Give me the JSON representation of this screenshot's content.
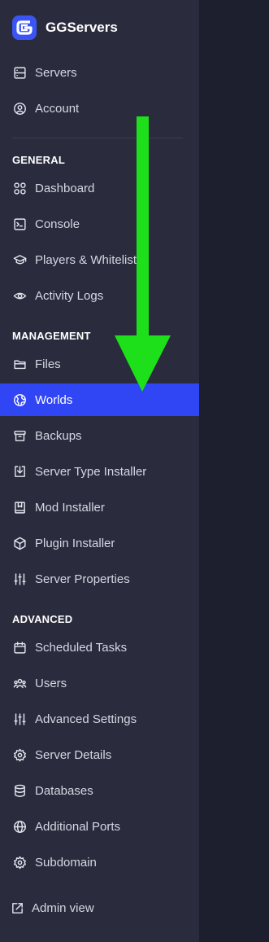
{
  "brand": {
    "name": "GGServers"
  },
  "top_nav": [
    {
      "label": "Servers",
      "icon": "server-icon"
    },
    {
      "label": "Account",
      "icon": "account-icon"
    }
  ],
  "general": {
    "heading": "GENERAL",
    "items": [
      {
        "label": "Dashboard",
        "icon": "dashboard-icon"
      },
      {
        "label": "Console",
        "icon": "console-icon"
      },
      {
        "label": "Players & Whitelist",
        "icon": "graduation-cap-icon"
      },
      {
        "label": "Activity Logs",
        "icon": "eye-icon"
      }
    ]
  },
  "management": {
    "heading": "MANAGEMENT",
    "items": [
      {
        "label": "Files",
        "icon": "folder-icon"
      },
      {
        "label": "Worlds",
        "icon": "globe-icon",
        "active": true
      },
      {
        "label": "Backups",
        "icon": "archive-icon"
      },
      {
        "label": "Server Type Installer",
        "icon": "download-icon"
      },
      {
        "label": "Mod Installer",
        "icon": "book-icon"
      },
      {
        "label": "Plugin Installer",
        "icon": "package-icon"
      },
      {
        "label": "Server Properties",
        "icon": "sliders-icon"
      }
    ]
  },
  "advanced": {
    "heading": "ADVANCED",
    "items": [
      {
        "label": "Scheduled Tasks",
        "icon": "calendar-icon"
      },
      {
        "label": "Users",
        "icon": "users-icon"
      },
      {
        "label": "Advanced Settings",
        "icon": "sliders-icon"
      },
      {
        "label": "Server Details",
        "icon": "gear-icon"
      },
      {
        "label": "Databases",
        "icon": "database-icon"
      },
      {
        "label": "Additional Ports",
        "icon": "globe-grid-icon"
      },
      {
        "label": "Subdomain",
        "icon": "gear-icon"
      }
    ]
  },
  "footer": {
    "label": "Admin view",
    "icon": "external-link-icon"
  },
  "colors": {
    "sidebar": "#2a2b3d",
    "active": "#3046f5",
    "arrow": "#1ee01a",
    "background": "#1e1f2e"
  }
}
